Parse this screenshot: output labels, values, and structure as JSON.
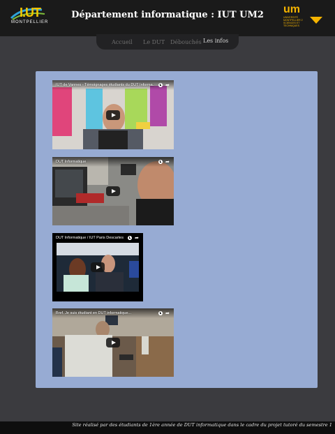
{
  "header": {
    "title": "Département informatique : IUT UM2",
    "logo_left": {
      "brand": "I.UT",
      "city": "MONTPELLIER"
    },
    "logo_right": {
      "brand": "um",
      "subtitle": "UNIVERSITÉ MONTPELLIER 2 SCIENCES ET TECHNIQUES"
    }
  },
  "nav": {
    "items": [
      {
        "label": "Accueil"
      },
      {
        "label": "Le DUT"
      },
      {
        "label": "Débouchés"
      },
      {
        "label": "Les infos"
      }
    ],
    "active": "Les infos"
  },
  "videos": [
    {
      "title": "IUT de Vannes - Témoignages étudiants du DUT Informa..."
    },
    {
      "title": "DUT Informatique"
    },
    {
      "title": "DUT Informatique / IUT Paris Descartes"
    },
    {
      "title": "Bref. Je suis étudiant en DUT informatique..."
    }
  ],
  "footer": {
    "text": "Site réalisé par des étudiants de 1ère année de DUT informatique dans le cadre du projet tutoré du semestre 1"
  },
  "colors": {
    "header_bg": "#1a1a1a",
    "page_bg": "#3b3b3f",
    "panel_bg": "#97abd3",
    "accent_gold": "#f5b400"
  },
  "icons": [
    "clock-icon",
    "share-icon",
    "play-icon"
  ]
}
